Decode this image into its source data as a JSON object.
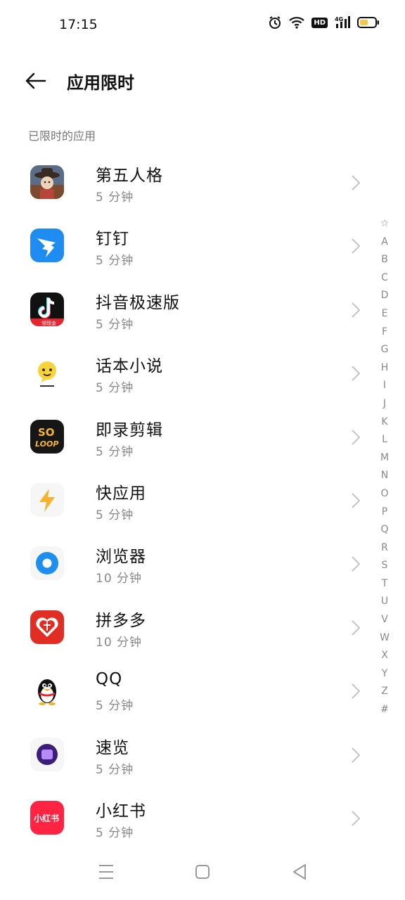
{
  "status": {
    "time": "17:15",
    "hd_label": "HD",
    "network_label": "4G",
    "icons": [
      "alarm-icon",
      "wifi-icon",
      "hd-icon",
      "cellular-icon",
      "battery-icon"
    ]
  },
  "header": {
    "title": "应用限时",
    "back_icon": "back-arrow-icon"
  },
  "section": {
    "label": "已限时的应用"
  },
  "apps": [
    {
      "name": "第五人格",
      "limit": "5 分钟"
    },
    {
      "name": "钉钉",
      "limit": "5 分钟"
    },
    {
      "name": "抖音极速版",
      "limit": "5 分钟"
    },
    {
      "name": "话本小说",
      "limit": "5 分钟"
    },
    {
      "name": "即录剪辑",
      "limit": "5 分钟"
    },
    {
      "name": "快应用",
      "limit": "5 分钟"
    },
    {
      "name": "浏览器",
      "limit": "10 分钟"
    },
    {
      "name": "拼多多",
      "limit": "10 分钟"
    },
    {
      "name": "QQ",
      "limit": "5 分钟"
    },
    {
      "name": "速览",
      "limit": "5 分钟"
    },
    {
      "name": "小红书",
      "limit": "5 分钟"
    }
  ],
  "icon_text": {
    "douyin_badge": "领现金",
    "solop_top": "SO",
    "solop_bottom": "LOOP",
    "xhs": "小红书"
  },
  "alphabet": [
    "☆",
    "A",
    "B",
    "C",
    "D",
    "E",
    "F",
    "G",
    "H",
    "I",
    "J",
    "K",
    "L",
    "M",
    "N",
    "O",
    "P",
    "Q",
    "R",
    "S",
    "T",
    "U",
    "V",
    "W",
    "X",
    "Y",
    "Z",
    "#"
  ],
  "navbar": [
    "menu-icon",
    "home-icon",
    "back-icon"
  ]
}
